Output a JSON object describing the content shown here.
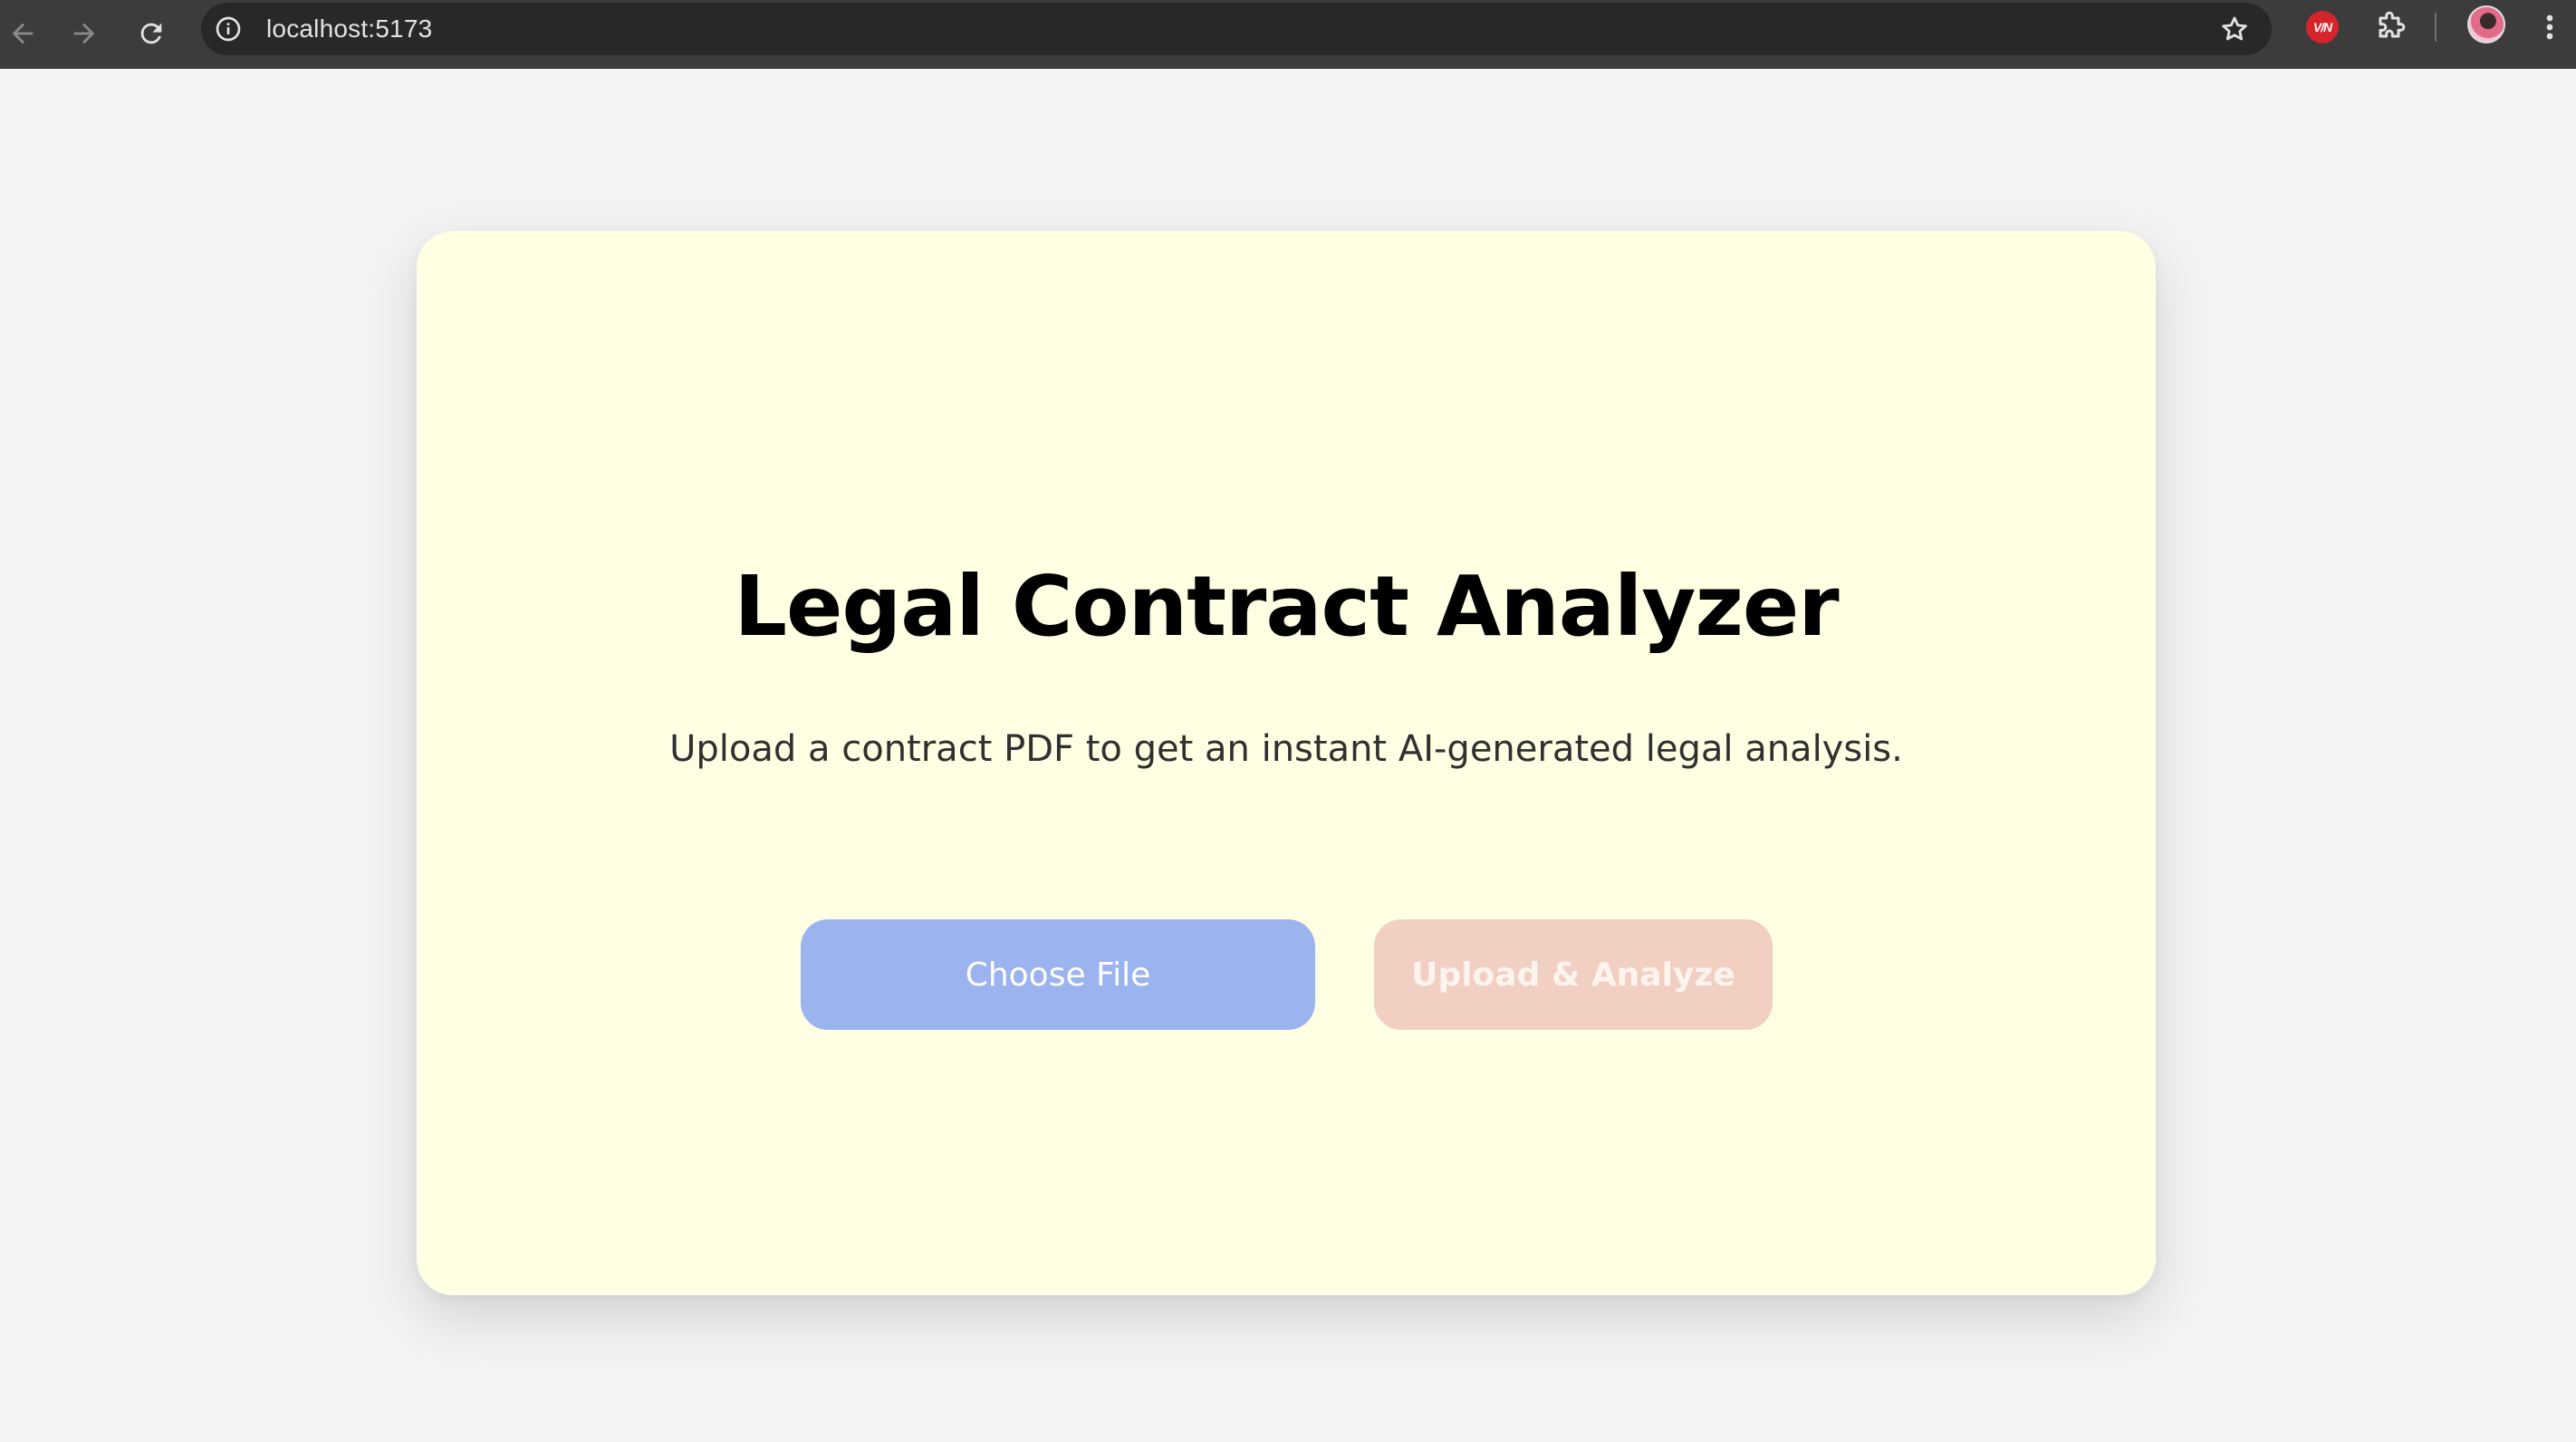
{
  "browser": {
    "url": "localhost:5173",
    "extension_badge": "V/N",
    "icons": {
      "back": "arrow-left-icon",
      "forward": "arrow-right-icon",
      "reload": "reload-icon",
      "site_info": "info-icon",
      "bookmark": "star-icon",
      "extensions": "puzzle-icon",
      "menu": "kebab-menu-icon"
    }
  },
  "page": {
    "title": "Legal Contract Analyzer",
    "subtitle": "Upload a contract PDF to get an instant AI-generated legal analysis.",
    "choose_file_label": "Choose File",
    "upload_label": "Upload & Analyze",
    "upload_disabled": true
  },
  "colors": {
    "page_background": "#f3f3f3",
    "card_background": "#ffffe3",
    "choose_button": "#9bb3ef",
    "upload_button": "#f2cfc3",
    "chrome_bar": "#3c3c3c"
  }
}
